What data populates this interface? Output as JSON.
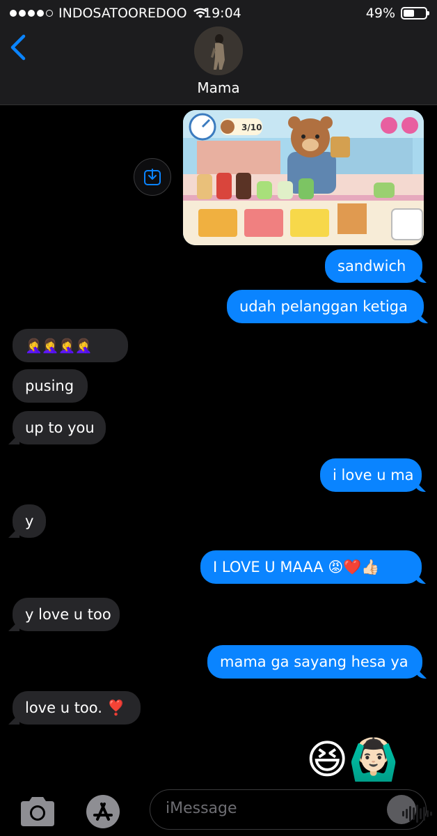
{
  "status_bar": {
    "carrier": "INDOSATOOREDOO",
    "time": "19:04",
    "battery": "49%"
  },
  "header": {
    "contact_name": "Mama"
  },
  "attachment": {
    "game_counter": "3/10"
  },
  "messages": [
    {
      "dir": "out",
      "text": "sandwich"
    },
    {
      "dir": "out",
      "text": "udah pelanggan ketiga"
    },
    {
      "dir": "in",
      "text": "🤦‍♀️🤦‍♀️🤦‍♀️🤦‍♀️"
    },
    {
      "dir": "in",
      "text": "pusing"
    },
    {
      "dir": "in",
      "text": "up to you"
    },
    {
      "dir": "out",
      "text": "i love u ma"
    },
    {
      "dir": "in",
      "text": "y"
    },
    {
      "dir": "out",
      "text": "I LOVE U MAAA 😡❤️👍🏻"
    },
    {
      "dir": "in",
      "text": "y love u too"
    },
    {
      "dir": "out",
      "text": "mama ga sayang hesa ya"
    },
    {
      "dir": "in",
      "text": "love u too. ❣️"
    },
    {
      "dir": "out",
      "text": "😆🙆🏻‍♂️"
    }
  ],
  "composer": {
    "placeholder": "iMessage"
  },
  "colors": {
    "outgoing": "#0a84ff",
    "incoming": "#262629",
    "background": "#000000"
  },
  "icons": [
    "back-chevron-icon",
    "save-to-photos-icon",
    "camera-icon",
    "app-store-icon",
    "audio-waveform-icon"
  ]
}
